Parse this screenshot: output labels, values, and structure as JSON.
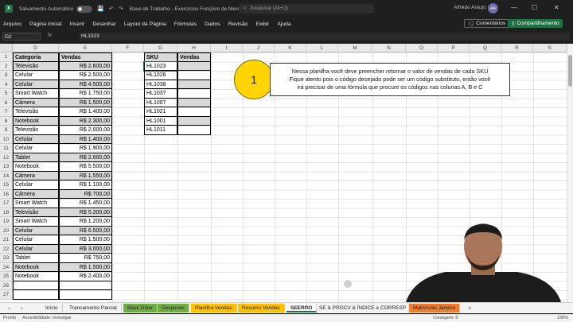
{
  "titlebar": {
    "autosave_label": "Salvamento Automático",
    "document_title": "Base de Trabalho - Exercícios Funções de Mercado",
    "search_placeholder": "Pesquisar (Alt+Q)",
    "user_name": "Alfredo Araujo",
    "user_initials": "AA"
  },
  "menu": {
    "items": [
      "Arquivo",
      "Página Inicial",
      "Inserir",
      "Desenhar",
      "Layout da Página",
      "Fórmulas",
      "Dados",
      "Revisão",
      "Exibir",
      "Ajuda"
    ],
    "comments_label": "Comentários",
    "share_label": "Compartilhamento"
  },
  "formula_bar": {
    "name_box": "G2",
    "fx": "fx",
    "formula": "HL1023"
  },
  "columns": [
    "D",
    "E",
    "F",
    "G",
    "H",
    "I",
    "J",
    "K",
    "L",
    "M",
    "N",
    "O",
    "P",
    "Q",
    "R",
    "S"
  ],
  "rows": [
    "1",
    "2",
    "3",
    "4",
    "5",
    "6",
    "7",
    "8",
    "9",
    "10",
    "11",
    "12",
    "13",
    "14",
    "15",
    "16",
    "17",
    "18",
    "19",
    "20",
    "21",
    "22",
    "23",
    "24",
    "25",
    "26",
    "27"
  ],
  "table1": {
    "header_category": "Categoria",
    "header_sales": "Vendas",
    "rows": [
      {
        "cat": "Televisão",
        "val": "R$ 2.600,00"
      },
      {
        "cat": "Celular",
        "val": "R$ 2.500,00"
      },
      {
        "cat": "Celular",
        "val": "R$ 4.500,00"
      },
      {
        "cat": "Smart Watch",
        "val": "R$ 1.750,00"
      },
      {
        "cat": "Câmera",
        "val": "R$ 1.500,00"
      },
      {
        "cat": "Televisão",
        "val": "R$ 1.400,00"
      },
      {
        "cat": "Notebook",
        "val": "R$ 2.300,00"
      },
      {
        "cat": "Televisão",
        "val": "R$ 2.000,00"
      },
      {
        "cat": "Celular",
        "val": "R$ 1.400,00"
      },
      {
        "cat": "Celular",
        "val": "R$ 1.900,00"
      },
      {
        "cat": "Tablet",
        "val": "R$ 2.000,00"
      },
      {
        "cat": "Notebook",
        "val": "R$ 5.500,00"
      },
      {
        "cat": "Câmera",
        "val": "R$ 1.550,00"
      },
      {
        "cat": "Celular",
        "val": "R$ 1.100,00"
      },
      {
        "cat": "Câmera",
        "val": "R$ 700,00"
      },
      {
        "cat": "Smart Watch",
        "val": "R$ 1.450,00"
      },
      {
        "cat": "Televisão",
        "val": "R$ 5.200,00"
      },
      {
        "cat": "Smart Watch",
        "val": "R$ 1.200,00"
      },
      {
        "cat": "Celular",
        "val": "R$ 6.500,00"
      },
      {
        "cat": "Celular",
        "val": "R$ 1.500,00"
      },
      {
        "cat": "Celular",
        "val": "R$ 3.000,00"
      },
      {
        "cat": "Tablet",
        "val": "R$ 750,00"
      },
      {
        "cat": "Notebook",
        "val": "R$ 1.500,00"
      },
      {
        "cat": "Notebook",
        "val": "R$ 2.400,00"
      }
    ]
  },
  "table2": {
    "header_sku": "SKU",
    "header_sales": "Vendas",
    "skus": [
      "HL1023",
      "HL1026",
      "HL1038",
      "HL1037",
      "HL1007",
      "HL1021",
      "HL1001",
      "HL1011"
    ]
  },
  "callout": {
    "number": "1",
    "line1": "Nessa planilha você deve preencher retornar o valor de vendas de cada SKU",
    "line2": "Fique atento pois o código desejado pode ser um código substituto, então você",
    "line3": "irá precisar de uma fórmula que procure os códigos nas colunas A, B e C"
  },
  "sheet_tabs": [
    {
      "label": "Início",
      "color": ""
    },
    {
      "label": "Trancamento Parcial",
      "color": ""
    },
    {
      "label": "Base Dólar",
      "color": "#70ad47"
    },
    {
      "label": "Despesas",
      "color": "#70ad47"
    },
    {
      "label": "Planilha Vendas",
      "color": "#ffc000"
    },
    {
      "label": "Resumo Vendas",
      "color": "#ffc000"
    },
    {
      "label": "SEERRO",
      "color": "active"
    },
    {
      "label": "SE & PROCV & ÍNDICE e CORRESP",
      "color": ""
    },
    {
      "label": "Matrículas Janeiro",
      "color": "#ed7d31"
    }
  ],
  "status": {
    "ready": "Pronto",
    "accessibility": "Acessibilidade: investigar",
    "count": "Contagem: 8",
    "zoom": "130%"
  }
}
